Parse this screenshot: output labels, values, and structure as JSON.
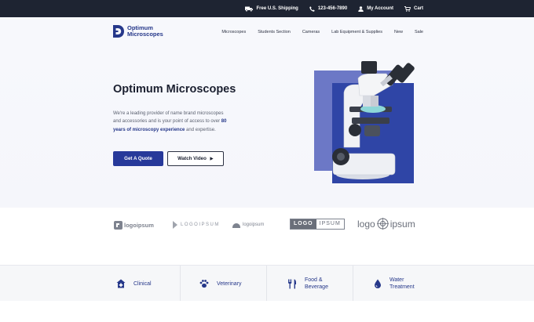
{
  "topbar": {
    "shipping": "Free U.S. Shipping",
    "phone": "123-456-7890",
    "account": "My Account",
    "cart": "Cart"
  },
  "header": {
    "logo_line1": "Optimum",
    "logo_line2": "Microscopes",
    "nav": [
      "Microscopes",
      "Students Section",
      "Cameras",
      "Lab Equipment & Supplies",
      "New",
      "Sale"
    ]
  },
  "hero": {
    "title": "Optimum Microscopes",
    "desc_part1": "We're a leading provider of name brand microscopes and accessories and is your point of access to over ",
    "desc_highlight": "80 years of microscopy experience",
    "desc_part2": " and expertise.",
    "primary_button": "Get A Quote",
    "secondary_button": "Watch Video"
  },
  "logos": [
    {
      "text": "logoipsum"
    },
    {
      "text_a": "LOGO",
      "text_b": "IPSUM"
    },
    {
      "text": "logoipsum"
    },
    {
      "text_a": "LOGO",
      "text_b": "IPSUM"
    },
    {
      "text_a": "logo",
      "text_b": "ipsum"
    }
  ],
  "categories": [
    {
      "line1": "Clinical",
      "line2": "",
      "icon": "hospital-icon"
    },
    {
      "line1": "Veterinary",
      "line2": "",
      "icon": "paw-icon"
    },
    {
      "line1": "Food &",
      "line2": "Beverage",
      "icon": "utensils-icon"
    },
    {
      "line1": "Water",
      "line2": "Treatment",
      "icon": "water-drop-icon"
    }
  ],
  "colors": {
    "topbar_bg": "#1e2432",
    "brand_blue": "#27399a",
    "hero_panel": "#6c78c6",
    "hero_panel_inner": "#2f45a6"
  }
}
